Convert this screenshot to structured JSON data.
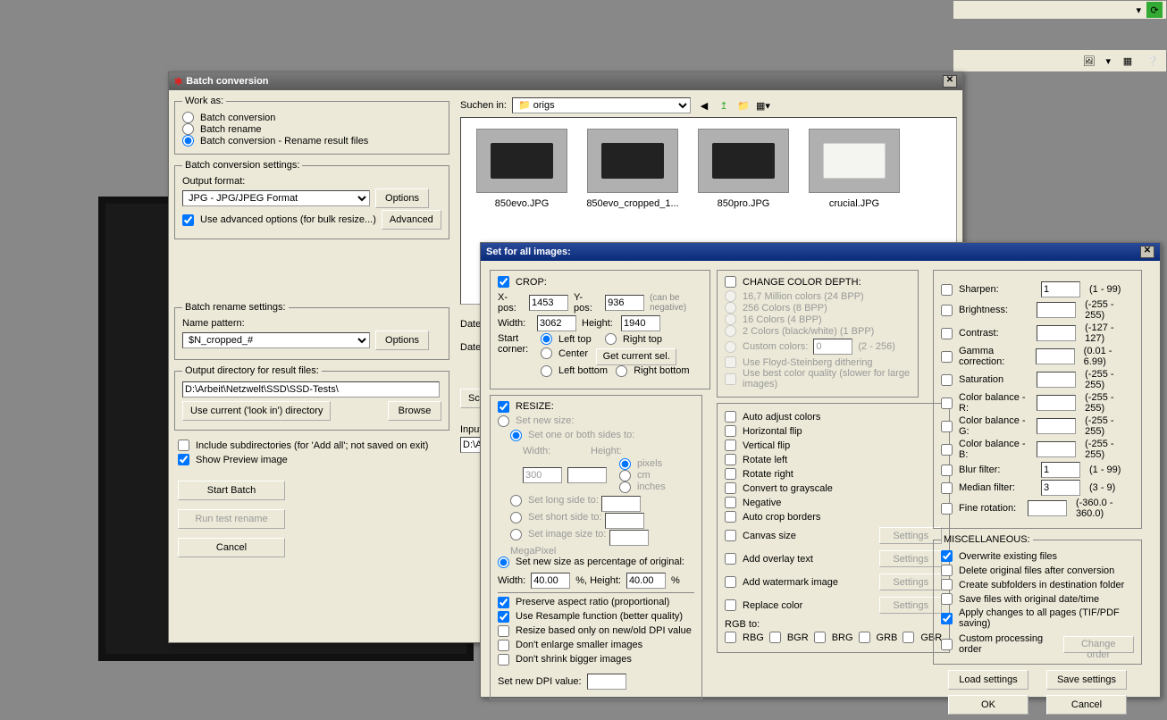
{
  "topstrip": {
    "refresh": "⟳"
  },
  "batchWin": {
    "title": "Batch conversion",
    "workAs": {
      "legend": "Work as:",
      "opt1": "Batch conversion",
      "opt2": "Batch rename",
      "opt3": "Batch conversion - Rename result files"
    },
    "convSettings": {
      "legend": "Batch conversion settings:",
      "outputFormatLabel": "Output format:",
      "outputFormat": "JPG - JPG/JPEG Format",
      "optionsBtn": "Options",
      "advOptionsCheck": "Use advanced options (for bulk resize...)",
      "advancedBtn": "Advanced"
    },
    "renameSettings": {
      "legend": "Batch rename settings:",
      "patternLabel": "Name pattern:",
      "pattern": "$N_cropped_#",
      "optionsBtn": "Options"
    },
    "outputDir": {
      "legend": "Output directory for result files:",
      "dir": "D:\\Arbeit\\Netzwelt\\SSD\\SSD-Tests\\",
      "useCurrentBtn": "Use current ('look in') directory",
      "browseBtn": "Browse"
    },
    "includeSub": "Include subdirectories (for 'Add all'; not saved on exit)",
    "preview": "Show Preview image",
    "startBtn": "Start Batch",
    "runTestBtn": "Run test rename",
    "cancelBtn": "Cancel",
    "suchen": "Suchen in:",
    "suchenFolder": "origs",
    "dateLbl": "Date",
    "scBtn": "Sc",
    "inputLbl": "Input",
    "inputVal": "D:\\Ar",
    "files": [
      {
        "name": "850evo.JPG"
      },
      {
        "name": "850evo_cropped_1..."
      },
      {
        "name": "850pro.JPG"
      },
      {
        "name": "crucial.JPG"
      }
    ]
  },
  "setAll": {
    "title": "Set for all images:",
    "crop": {
      "check": "CROP:",
      "xposLbl": "X-pos:",
      "xpos": "1453",
      "yposLbl": "Y-pos:",
      "ypos": "936",
      "widthLbl": "Width:",
      "width": "3062",
      "heightLbl": "Height:",
      "height": "1940",
      "note": "(can be negative)",
      "startCorner": "Start corner:",
      "lt": "Left top",
      "rt": "Right top",
      "center": "Center",
      "getSel": "Get current sel.",
      "lb": "Left bottom",
      "rb": "Right bottom"
    },
    "resize": {
      "check": "RESIZE:",
      "setNew": "Set new size:",
      "oneOrBoth": "Set one or both sides to:",
      "widthLbl": "Width:",
      "heightLbl": "Height:",
      "widthVal": "300",
      "longSide": "Set long side to:",
      "shortSide": "Set short side to:",
      "imgSize": "Set image size to:",
      "mega": "MegaPixel",
      "units": {
        "px": "pixels",
        "cm": "cm",
        "in": "inches"
      },
      "percent": "Set new size as percentage of original:",
      "pWidthLbl": "Width:",
      "pWidth": "40.00",
      "pHeightLbl": "%, Height:",
      "pHeight": "40.00",
      "pct": "%",
      "preserve": "Preserve aspect ratio (proportional)",
      "resample": "Use Resample function (better quality)",
      "dpiOnly": "Resize based only on new/old DPI value",
      "dontEnlarge": "Don't enlarge smaller images",
      "dontShrink": "Don't shrink bigger images",
      "newDpi": "Set new DPI value:"
    },
    "colorDepth": {
      "check": "CHANGE COLOR DEPTH:",
      "c1": "16,7 Million colors (24 BPP)",
      "c2": "256 Colors (8 BPP)",
      "c3": "16 Colors (4 BPP)",
      "c4": "2 Colors (black/white) (1 BPP)",
      "c5": "Custom colors:",
      "c5val": "0",
      "c5range": "(2 - 256)",
      "fs": "Use Floyd-Steinberg dithering",
      "best": "Use best color quality (slower for large images)"
    },
    "flags": {
      "autoAdjust": "Auto adjust colors",
      "hflip": "Horizontal flip",
      "vflip": "Vertical flip",
      "rotL": "Rotate left",
      "rotR": "Rotate right",
      "gray": "Convert to grayscale",
      "neg": "Negative",
      "autoCrop": "Auto crop borders",
      "canvas": "Canvas size",
      "overlay": "Add overlay text",
      "water": "Add watermark image",
      "replace": "Replace color",
      "settingsBtn": "Settings"
    },
    "rgb": {
      "label": "RGB to:",
      "rbg": "RBG",
      "bgr": "BGR",
      "brg": "BRG",
      "grb": "GRB",
      "gbr": "GBR"
    },
    "adjust": {
      "sharpen": {
        "lbl": "Sharpen:",
        "val": "1",
        "rng": "(1  -  99)"
      },
      "bright": {
        "lbl": "Brightness:",
        "val": "",
        "rng": "(-255  -  255)"
      },
      "contrast": {
        "lbl": "Contrast:",
        "val": "",
        "rng": "(-127  -  127)"
      },
      "gamma": {
        "lbl": "Gamma correction:",
        "val": "",
        "rng": "(0.01  -  6.99)"
      },
      "sat": {
        "lbl": "Saturation",
        "val": "",
        "rng": "(-255  -  255)"
      },
      "cbr": {
        "lbl": "Color balance - R:",
        "val": "",
        "rng": "(-255  -  255)"
      },
      "cbg": {
        "lbl": "Color balance - G:",
        "val": "",
        "rng": "(-255  -  255)"
      },
      "cbb": {
        "lbl": "Color balance - B:",
        "val": "",
        "rng": "(-255  -  255)"
      },
      "blur": {
        "lbl": "Blur filter:",
        "val": "1",
        "rng": "(1  -  99)"
      },
      "median": {
        "lbl": "Median filter:",
        "val": "3",
        "rng": "(3  -  9)"
      },
      "fineRot": {
        "lbl": "Fine rotation:",
        "val": "",
        "rng": "(-360.0  -  360.0)"
      }
    },
    "misc": {
      "legend": "MISCELLANEOUS:",
      "overwrite": "Overwrite existing files",
      "delOrig": "Delete original files after conversion",
      "subfolders": "Create subfolders in destination folder",
      "origDate": "Save files with original date/time",
      "allPages": "Apply changes to all pages (TIF/PDF saving)",
      "customOrder": "Custom processing order",
      "changeOrderBtn": "Change order"
    },
    "loadBtn": "Load settings",
    "saveBtn": "Save settings",
    "okBtn": "OK",
    "cancelBtn": "Cancel"
  }
}
